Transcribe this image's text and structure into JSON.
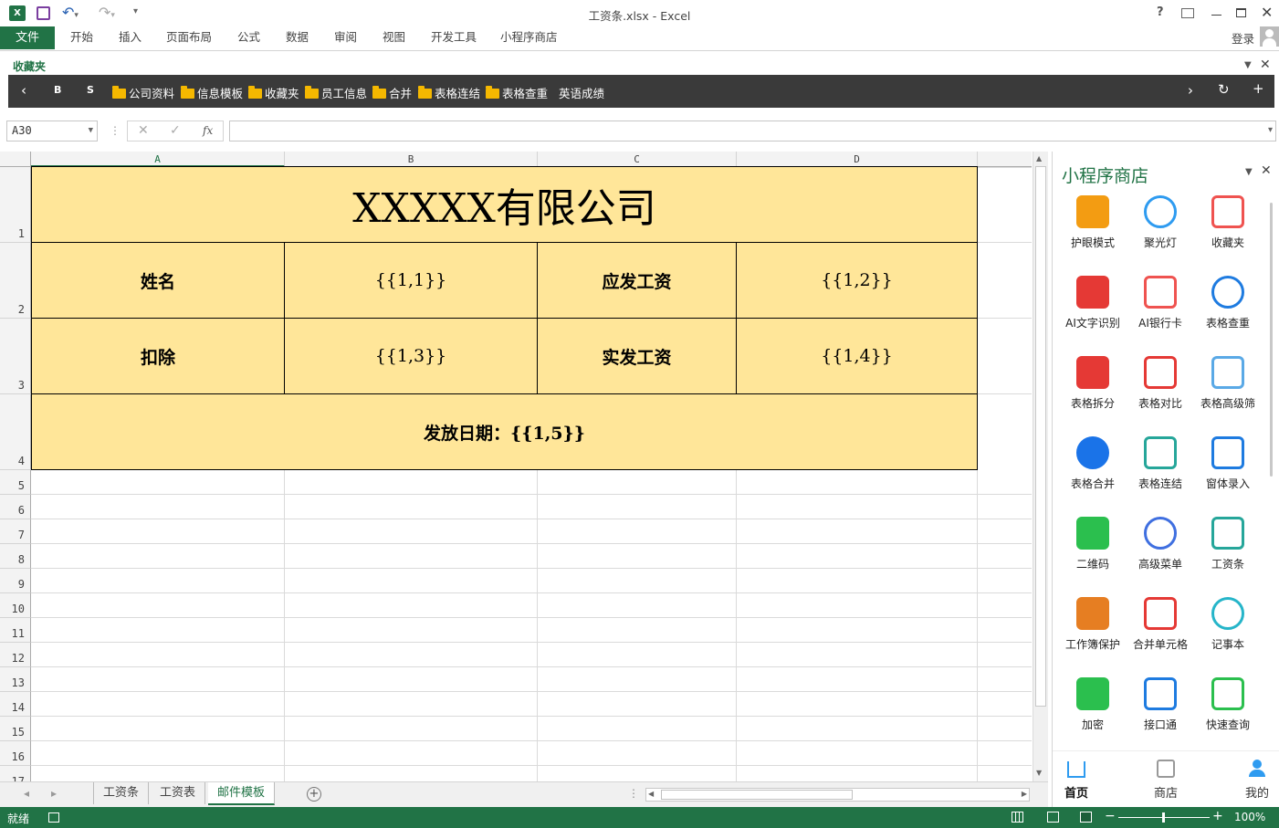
{
  "window": {
    "title": "工资条.xlsx - Excel",
    "help": "?",
    "login": "登录"
  },
  "ribbon": {
    "file": "文件",
    "tabs": [
      "开始",
      "插入",
      "页面布局",
      "公式",
      "数据",
      "审阅",
      "视图",
      "开发工具",
      "小程序商店"
    ]
  },
  "favorites": {
    "label": "收藏夹",
    "items": [
      "B",
      "S",
      "公司资料",
      "信息模板",
      "收藏夹",
      "员工信息",
      "合并",
      "表格连结",
      "表格查重",
      "英语成绩"
    ]
  },
  "formula_bar": {
    "name_box": "A30",
    "fx": "fx",
    "value": ""
  },
  "columns": [
    "A",
    "B",
    "C",
    "D"
  ],
  "rows": [
    "1",
    "2",
    "3",
    "4",
    "5",
    "6",
    "7",
    "8",
    "9",
    "10",
    "11",
    "12",
    "13",
    "14",
    "15",
    "16",
    "17"
  ],
  "sheet": {
    "title": "XXXXX有限公司",
    "name_label": "姓名",
    "name_value": "{{1,1}}",
    "gross_label": "应发工资",
    "gross_value": "{{1,2}}",
    "deduct_label": "扣除",
    "deduct_value": "{{1,3}}",
    "net_label": "实发工资",
    "net_value": "{{1,4}}",
    "date_line": "发放日期：{{1,5}}"
  },
  "sheet_tabs": [
    "工资条",
    "工资表",
    "邮件模板"
  ],
  "active_sheet": "邮件模板",
  "status": {
    "ready": "就绪",
    "zoom": "100%"
  },
  "panel": {
    "title": "小程序商店",
    "apps": [
      {
        "label": "护眼模式",
        "icon": "eye-icon",
        "color": "#f39c12"
      },
      {
        "label": "聚光灯",
        "icon": "lightbulb-icon",
        "color": "#2e9bf0"
      },
      {
        "label": "收藏夹",
        "icon": "favorite-folder-icon",
        "color": "#ef5350"
      },
      {
        "label": "AI文字识别",
        "icon": "text-recognition-icon",
        "color": "#e53935"
      },
      {
        "label": "AI银行卡",
        "icon": "bank-card-icon",
        "color": "#ef5350"
      },
      {
        "label": "表格查重",
        "icon": "duplicate-check-icon",
        "color": "#1e7be0"
      },
      {
        "label": "表格拆分",
        "icon": "split-icon",
        "color": "#e53935"
      },
      {
        "label": "表格对比",
        "icon": "compare-icon",
        "color": "#e53935"
      },
      {
        "label": "表格高级筛选",
        "icon": "advanced-grid-icon",
        "color": "#5aa9e6"
      },
      {
        "label": "表格合并",
        "icon": "merge-icon",
        "color": "#1a73e8"
      },
      {
        "label": "表格连结",
        "icon": "link-icon",
        "color": "#26a69a"
      },
      {
        "label": "窗体录入",
        "icon": "form-icon",
        "color": "#1e7be0"
      },
      {
        "label": "二维码",
        "icon": "qrcode-icon",
        "color": "#2bbf4e"
      },
      {
        "label": "高级菜单",
        "icon": "menu-settings-icon",
        "color": "#3f6fe0"
      },
      {
        "label": "工资条",
        "icon": "payslip-icon",
        "color": "#26a69a"
      },
      {
        "label": "工作簿保护",
        "icon": "shield-icon",
        "color": "#e67e22"
      },
      {
        "label": "合并单元格",
        "icon": "merge-cells-icon",
        "color": "#e53935"
      },
      {
        "label": "记事本",
        "icon": "notebook-icon",
        "color": "#26b5c9"
      },
      {
        "label": "加密",
        "icon": "lock-icon",
        "color": "#2bbf4e"
      },
      {
        "label": "接口通",
        "icon": "monitor-icon",
        "color": "#1e7be0"
      },
      {
        "label": "快速查询",
        "icon": "search-check-icon",
        "color": "#2bbf4e"
      }
    ],
    "nav": [
      "首页",
      "商店",
      "我的"
    ]
  }
}
